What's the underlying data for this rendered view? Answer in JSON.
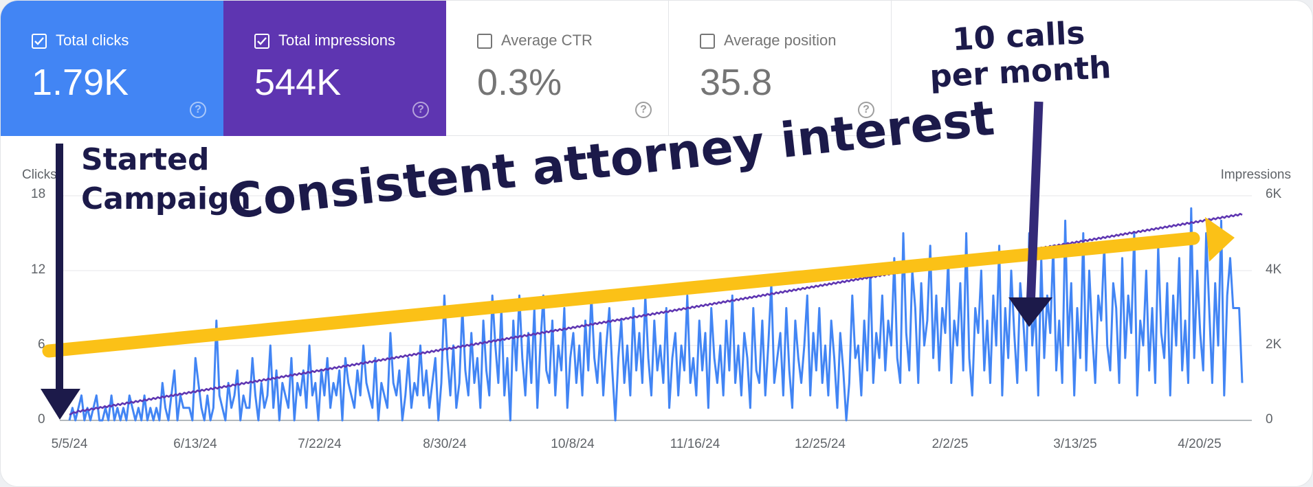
{
  "cards": [
    {
      "label": "Total clicks",
      "value": "1.79K",
      "checked": true,
      "color": "#4285f4"
    },
    {
      "label": "Total impressions",
      "value": "544K",
      "checked": true,
      "color": "#5e35b1"
    },
    {
      "label": "Average CTR",
      "value": "0.3%",
      "checked": false
    },
    {
      "label": "Average position",
      "value": "35.8",
      "checked": false
    }
  ],
  "help_glyph": "?",
  "annotations": {
    "calls": "10 calls\nper month",
    "started": "Started\nCampaign",
    "trend": "Consistent attorney interest"
  },
  "colors": {
    "clicks": "#4285f4",
    "impressions": "#5e35b1",
    "trend_arrow": "#fbc117",
    "annotation_text": "#1c1a4a"
  },
  "chart_data": {
    "type": "line",
    "x_ticks": [
      "5/5/24",
      "6/13/24",
      "7/22/24",
      "8/30/24",
      "10/8/24",
      "11/16/24",
      "12/25/24",
      "2/2/25",
      "3/13/25",
      "4/20/25"
    ],
    "x_range": [
      "5/5/24",
      "5/11/25"
    ],
    "left_axis": {
      "label": "Clicks",
      "ticks": [
        "0",
        "6",
        "12",
        "18"
      ],
      "range": [
        0,
        18
      ]
    },
    "right_axis": {
      "label": "Impressions",
      "ticks": [
        "0",
        "2K",
        "4K",
        "6K"
      ],
      "range": [
        0,
        6000
      ]
    },
    "series": [
      {
        "name": "Clicks",
        "axis": "left",
        "color": "#4285f4",
        "values": [
          0,
          1,
          0,
          1,
          2,
          0,
          1,
          0,
          1,
          2,
          0,
          0,
          1,
          0,
          2,
          0,
          1,
          0,
          1,
          0,
          2,
          1,
          0,
          1,
          0,
          2,
          0,
          1,
          0,
          1,
          0,
          3,
          1,
          0,
          2,
          4,
          0,
          2,
          1,
          1,
          1,
          0,
          5,
          3,
          1,
          0,
          2,
          0,
          1,
          8,
          2,
          1,
          0,
          3,
          1,
          2,
          4,
          0,
          2,
          1,
          1,
          5,
          2,
          0,
          3,
          1,
          2,
          6,
          1,
          4,
          0,
          3,
          2,
          1,
          5,
          0,
          3,
          2,
          4,
          1,
          6,
          2,
          3,
          0,
          4,
          2,
          5,
          1,
          3,
          2,
          4,
          0,
          5,
          3,
          2,
          1,
          4,
          2,
          6,
          3,
          2,
          1,
          5,
          0,
          3,
          2,
          1,
          7,
          3,
          2,
          4,
          0,
          2,
          5,
          1,
          3,
          2,
          6,
          2,
          4,
          1,
          3,
          5,
          0,
          3,
          10,
          5,
          2,
          6,
          1,
          3,
          9,
          4,
          2,
          7,
          3,
          5,
          1,
          8,
          4,
          2,
          10,
          6,
          3,
          9,
          2,
          5,
          0,
          8,
          4,
          10,
          5,
          2,
          7,
          3,
          9,
          1,
          6,
          10,
          4,
          3,
          8,
          2,
          6,
          4,
          9,
          1,
          5,
          7,
          3,
          6,
          2,
          8,
          4,
          10,
          5,
          3,
          7,
          2,
          6,
          9,
          4,
          0,
          5,
          8,
          3,
          6,
          2,
          9,
          4,
          7,
          3,
          10,
          5,
          2,
          8,
          4,
          6,
          3,
          9,
          1,
          5,
          7,
          2,
          6,
          4,
          10,
          3,
          5,
          2,
          8,
          4,
          7,
          1,
          9,
          5,
          3,
          6,
          2,
          8,
          4,
          10,
          3,
          6,
          2,
          7,
          5,
          1,
          9,
          4,
          3,
          8,
          2,
          6,
          11,
          3,
          5,
          7,
          2,
          9,
          4,
          1,
          8,
          5,
          3,
          6,
          10,
          2,
          7,
          4,
          9,
          3,
          6,
          2,
          8,
          5,
          1,
          7,
          4,
          0,
          3,
          10,
          5,
          6,
          2,
          8,
          4,
          12,
          3,
          7,
          5,
          10,
          4,
          8,
          6,
          13,
          5,
          3,
          15,
          7,
          4,
          12,
          9,
          3,
          11,
          6,
          8,
          14,
          5,
          10,
          4,
          9,
          7,
          13,
          3,
          8,
          6,
          11,
          4,
          15,
          5,
          2,
          9,
          7,
          12,
          4,
          8,
          3,
          10,
          6,
          14,
          2,
          9,
          5,
          12,
          7,
          3,
          11,
          8,
          4,
          15,
          6,
          9,
          2,
          13,
          5,
          10,
          7,
          14,
          4,
          8,
          3,
          16,
          6,
          11,
          2,
          9,
          5,
          15,
          4,
          12,
          7,
          3,
          10,
          8,
          14,
          6,
          4,
          11,
          9,
          3,
          13,
          5,
          10,
          7,
          15,
          2,
          8,
          6,
          12,
          4,
          9,
          3,
          14,
          7,
          5,
          11,
          2,
          10,
          6,
          13,
          4,
          8,
          3,
          17,
          5,
          12,
          7,
          4,
          15,
          9,
          3,
          11,
          6,
          16,
          2,
          10,
          13,
          9,
          9,
          9,
          3
        ]
      },
      {
        "name": "Impressions",
        "axis": "right",
        "color": "#5e35b1",
        "values": [
          150,
          180,
          220,
          200,
          260,
          230,
          280,
          250,
          300,
          270,
          320,
          290,
          340,
          310,
          360,
          330,
          380,
          350,
          400,
          370,
          420,
          390,
          440,
          410,
          460,
          430,
          480,
          450,
          500,
          470,
          520,
          490,
          540,
          510,
          560,
          530,
          580,
          550,
          600,
          570,
          620,
          590,
          640,
          610,
          660,
          630,
          680,
          650,
          700,
          670,
          720,
          690,
          740,
          710,
          760,
          730,
          780,
          750,
          800,
          770,
          820,
          790,
          840,
          810,
          860,
          830,
          880,
          850,
          900,
          870,
          920,
          890,
          940,
          910,
          960,
          930,
          980,
          950,
          1000,
          970,
          1020,
          990,
          1040,
          1010,
          1060,
          1030,
          1080,
          1050,
          1100,
          1070,
          1120,
          1090,
          1140,
          1110,
          1160,
          1130,
          1180,
          1150,
          1200,
          1170,
          1220,
          1190,
          1240,
          1210,
          1260,
          1230,
          1280,
          1250,
          1300,
          1270,
          1320,
          1290,
          1340,
          1310,
          1360,
          1330,
          1380,
          1350,
          1400,
          1370,
          1420,
          1390,
          1440,
          1410,
          1460,
          1430,
          1480,
          1450,
          1500,
          1470,
          1520,
          1490,
          1540,
          1510,
          1560,
          1530,
          1580,
          1550,
          1600,
          1570,
          1620,
          1590,
          1640,
          1610,
          1660,
          1630,
          1680,
          1650,
          1700,
          1670,
          1720,
          1690,
          1740,
          1710,
          1760,
          1730,
          1780,
          1750,
          1800,
          1770,
          1820,
          1790,
          1840,
          1810,
          1860,
          1830,
          1880,
          1850,
          1900,
          1870,
          1920,
          1890,
          1940,
          1910,
          1960,
          1930,
          1980,
          1950,
          2000,
          1970,
          2020,
          1990,
          2040,
          2010,
          2060,
          2030,
          2080,
          2050,
          2100,
          2070,
          2120,
          2090,
          2140,
          2110,
          2160,
          2130,
          2180,
          2150,
          2200,
          2170,
          2220,
          2190,
          2240,
          2210,
          2260,
          2230,
          2280,
          2250,
          2300,
          2270,
          2320,
          2290,
          2340,
          2310,
          2360,
          2330,
          2380,
          2350,
          2400,
          2370,
          2420,
          2390,
          2440,
          2410,
          2460,
          2430,
          2480,
          2450,
          2500,
          2470,
          2520,
          2490,
          2540,
          2510,
          2560,
          2530,
          2580,
          2550,
          2600,
          2570,
          2620,
          2590,
          2640,
          2610,
          2660,
          2630,
          2680,
          2650,
          2700,
          2670,
          2720,
          2690,
          2740,
          2710,
          2760,
          2730,
          2780,
          2750,
          2800,
          2770,
          2820,
          2790,
          2840,
          2810,
          2860,
          2830,
          2880,
          2850,
          2900,
          2870,
          2920,
          2890,
          2940,
          2910,
          2960,
          2930,
          2980,
          2950,
          3000,
          2970,
          3020,
          2990,
          3040,
          3010,
          3060,
          3030,
          3080,
          3050,
          3100,
          3070,
          3120,
          3090,
          3140,
          3110,
          3160,
          3130,
          3180,
          3150,
          3200,
          3170,
          3220,
          3190,
          3240,
          3210,
          3260,
          3230,
          3280,
          3250,
          3300,
          3270,
          3320,
          3290,
          3340,
          3310,
          3360,
          3330,
          3380,
          3350,
          3400,
          3370,
          3420,
          3390,
          3440,
          3410,
          3460,
          3430,
          3480,
          3450,
          3500,
          3470,
          3520,
          3490,
          3540,
          3510,
          3560,
          3530,
          3580,
          3550,
          3600,
          3570,
          3620,
          3590,
          3640,
          3610,
          3660,
          3630,
          3680,
          3650,
          3700,
          3670,
          3720,
          3690,
          3740,
          3710,
          3760,
          3730,
          3780,
          3750,
          3800,
          3770,
          3820,
          3790,
          3840,
          3810,
          3860,
          3830,
          3880,
          3850,
          3900,
          3870,
          3920,
          3890,
          3940,
          3910,
          3960,
          3930,
          3980,
          3950,
          4000,
          3970,
          4020,
          3990,
          4040,
          4010,
          4060,
          4030,
          4080,
          4050,
          4100,
          4070,
          4120,
          4090,
          4140,
          4110,
          4160,
          4130,
          4180,
          4150,
          4200,
          4170,
          4220,
          4190,
          4240,
          4210,
          4260,
          4230,
          4280,
          4250,
          4300,
          4270,
          4320,
          4290,
          4340,
          4310,
          4360,
          4330,
          4380,
          4350,
          4400,
          4370,
          4420,
          4390,
          4440,
          4410,
          4460,
          4430,
          4480,
          4450,
          4500,
          4470,
          4520,
          4490,
          4540,
          4510,
          4560,
          4530,
          4580,
          4550,
          4600,
          4570,
          4620,
          4590,
          4640,
          4610,
          4660,
          4630,
          4680,
          4650,
          4700,
          4670,
          4720,
          4690,
          4740,
          4710,
          4760,
          4730,
          4780,
          4750,
          4800,
          4770,
          4820,
          4790,
          4840,
          4810,
          4860,
          4830,
          4880,
          4850,
          4900,
          4870,
          4920,
          4890,
          4940,
          4910,
          4960,
          4930,
          4980,
          4950,
          5000,
          4970,
          5020,
          4990,
          5040,
          5010,
          5060,
          5030,
          5080,
          5050,
          5100,
          5070,
          5120,
          5090,
          5140,
          5110,
          5160,
          5130,
          5180,
          5150,
          5200,
          5170,
          5220,
          5190,
          5240,
          5210,
          5260,
          5230,
          5280,
          5250,
          5300,
          5270,
          5320,
          5290,
          5340,
          5310,
          5360,
          5330,
          5380,
          5350,
          5400,
          5370,
          5420,
          5390,
          5440,
          5410,
          5460,
          5430,
          5480,
          5450,
          5500,
          5470,
          5520,
          5490
        ]
      }
    ],
    "grid": true
  }
}
